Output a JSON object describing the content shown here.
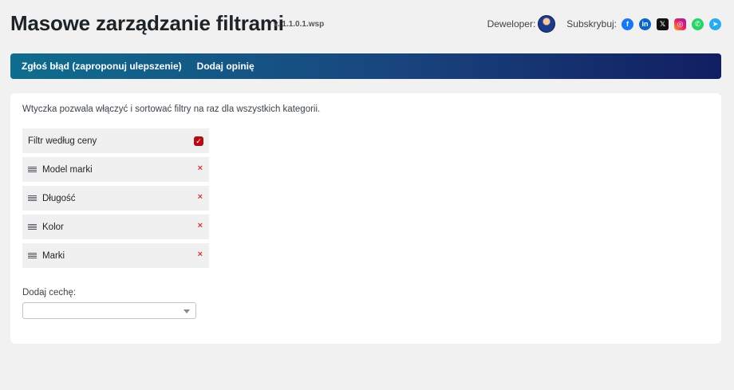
{
  "header": {
    "title": "Masowe zarządzanie filtrami",
    "version": "v. 1.1.0.1.wsp",
    "developer_label": "Deweloper:",
    "subscribe_label": "Subskrybuj:",
    "socials": [
      {
        "icon": "facebook-icon",
        "glyph": "f",
        "color": "#1877f2"
      },
      {
        "icon": "linkedin-icon",
        "glyph": "in",
        "color": "#0a66c2"
      },
      {
        "icon": "x-twitter-icon",
        "glyph": "𝕏",
        "color": "#111111"
      },
      {
        "icon": "instagram-icon",
        "glyph": "◎",
        "color": "#e91e63"
      },
      {
        "icon": "whatsapp-icon",
        "glyph": "✆",
        "color": "#25d366"
      },
      {
        "icon": "telegram-icon",
        "glyph": "➤",
        "color": "#2aabee"
      }
    ]
  },
  "nav": {
    "report_bug": "Zgłoś błąd (zaproponuj ulepszenie)",
    "add_review": "Dodaj opinię"
  },
  "panel": {
    "description": "Wtyczka pozwala włączyć i sortować filtry na raz dla wszystkich kategorii.",
    "price_filter": {
      "label": "Filtr według ceny",
      "checked": true
    },
    "filters": [
      {
        "label": "Model marki"
      },
      {
        "label": "Długość"
      },
      {
        "label": "Kolor"
      },
      {
        "label": "Marki"
      }
    ],
    "remove_glyph": "×",
    "add_attribute_label": "Dodaj cechę:",
    "add_attribute_value": ""
  }
}
